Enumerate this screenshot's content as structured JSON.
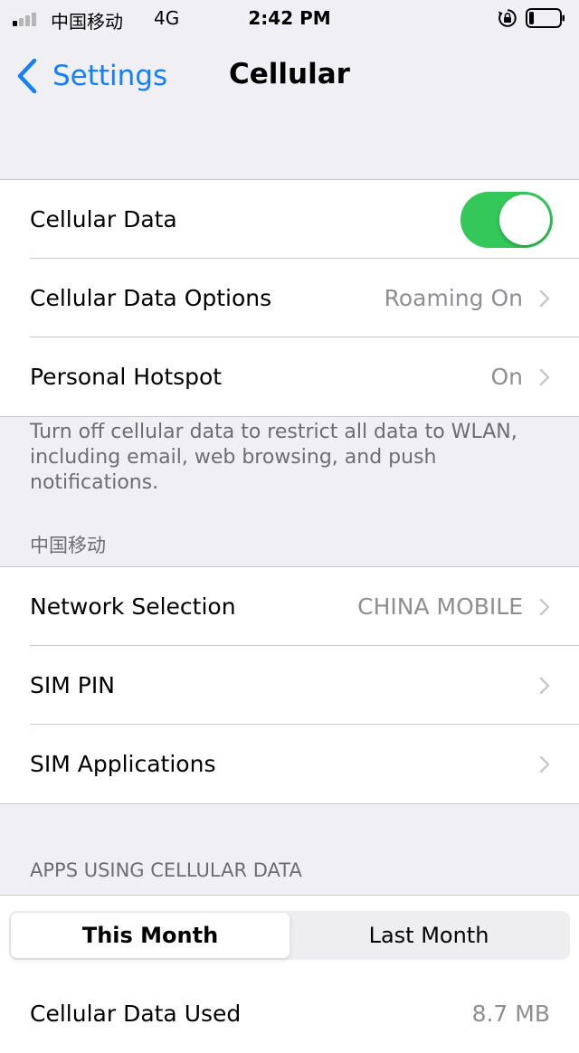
{
  "status_bar": {
    "carrier": "中国移动",
    "network": "4G",
    "time": "2:42 PM"
  },
  "nav": {
    "back_label": "Settings",
    "title": "Cellular"
  },
  "group1": {
    "cellular_data": {
      "label": "Cellular Data",
      "enabled": true
    },
    "cellular_data_options": {
      "label": "Cellular Data Options",
      "value": "Roaming On"
    },
    "personal_hotspot": {
      "label": "Personal Hotspot",
      "value": "On"
    }
  },
  "footer_note": "Turn off cellular data to restrict all data to WLAN, including email, web browsing, and push notifications.",
  "carrier_section": {
    "header": "中国移动",
    "network_selection": {
      "label": "Network Selection",
      "value": "CHINA MOBILE"
    },
    "sim_pin": {
      "label": "SIM PIN"
    },
    "sim_applications": {
      "label": "SIM Applications"
    }
  },
  "apps_section": {
    "header": "APPS USING CELLULAR DATA",
    "segments": [
      "This Month",
      "Last Month"
    ],
    "selected_segment": "This Month",
    "data_used": {
      "label": "Cellular Data Used",
      "value": "8.7 MB"
    }
  },
  "colors": {
    "accent": "#147efb",
    "toggle_on": "#34c759",
    "background": "#efeff4",
    "secondary_text": "#8e8e93"
  }
}
